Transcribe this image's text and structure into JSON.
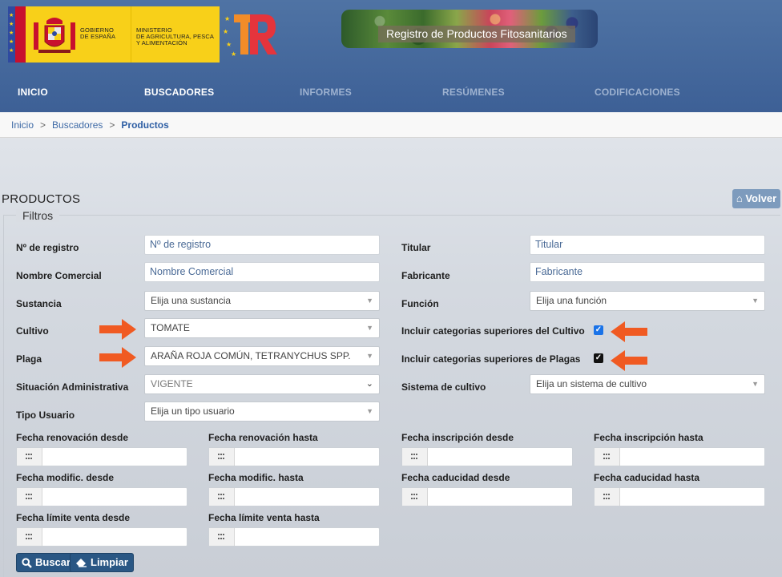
{
  "header": {
    "gov_line1": "GOBIERNO",
    "gov_line2": "DE ESPAÑA",
    "ministry_line1": "MINISTERIO",
    "ministry_line2": "DE AGRICULTURA, PESCA",
    "ministry_line3": "Y ALIMENTACIÓN",
    "banner_title": "Registro de Productos Fitosanitarios",
    "colors": {
      "header_blue": "#4a6fa5",
      "logo_yellow": "#f8d019",
      "tr_red": "#e5343c",
      "tr_orange": "#f28c28"
    }
  },
  "nav": {
    "items": [
      {
        "label": "INICIO",
        "active": true
      },
      {
        "label": "BUSCADORES",
        "active": true
      },
      {
        "label": "INFORMES",
        "active": false
      },
      {
        "label": "RESÚMENES",
        "active": false
      },
      {
        "label": "CODIFICACIONES",
        "active": false
      }
    ]
  },
  "breadcrumb": {
    "items": [
      "Inicio",
      "Buscadores",
      "Productos"
    ],
    "separator": ">"
  },
  "page": {
    "title": "PRODUCTOS",
    "back_label": "Volver",
    "fieldset_legend": "Filtros"
  },
  "form": {
    "registro": {
      "label": "Nº de registro",
      "placeholder": "Nº de registro"
    },
    "titular": {
      "label": "Titular",
      "placeholder": "Titular"
    },
    "nombre_comercial": {
      "label": "Nombre Comercial",
      "placeholder": "Nombre Comercial"
    },
    "fabricante": {
      "label": "Fabricante",
      "placeholder": "Fabricante"
    },
    "sustancia": {
      "label": "Sustancia",
      "value": "Elija una sustancia"
    },
    "funcion": {
      "label": "Función",
      "value": "Elija una función"
    },
    "cultivo": {
      "label": "Cultivo",
      "value": "TOMATE"
    },
    "incluir_cultivo": {
      "label": "Incluir categorias superiores del Cultivo",
      "checked": true
    },
    "plaga": {
      "label": "Plaga",
      "value": "ARAÑA ROJA COMÚN, TETRANYCHUS SPP."
    },
    "incluir_plagas": {
      "label": "Incluir categorias superiores de Plagas",
      "checked": true
    },
    "situacion": {
      "label": "Situación Administrativa",
      "value": "VIGENTE"
    },
    "sistema_cultivo": {
      "label": "Sistema de cultivo",
      "value": "Elija un sistema de cultivo"
    },
    "tipo_usuario": {
      "label": "Tipo Usuario",
      "value": "Elija un tipo usuario"
    },
    "dates": [
      "Fecha renovación desde",
      "Fecha renovación hasta",
      "Fecha inscripción desde",
      "Fecha inscripción hasta",
      "Fecha modific. desde",
      "Fecha modific. hasta",
      "Fecha caducidad desde",
      "Fecha caducidad hasta",
      "Fecha límite venta desde",
      "Fecha límite venta hasta"
    ],
    "buscar_label": "Buscar",
    "limpiar_label": "Limpiar"
  },
  "annotations": {
    "arrow_color": "#f05a22"
  }
}
